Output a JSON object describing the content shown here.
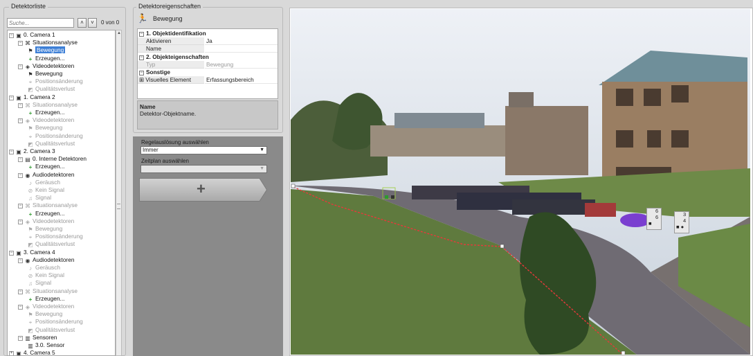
{
  "left": {
    "title": "Detektorliste",
    "search_placeholder": "Suche...",
    "up_icon": "chevron-up-icon",
    "down_icon": "chevron-down-icon",
    "count_text": "0 von 0",
    "tree": [
      {
        "label": "0. Camera 1",
        "level": 0,
        "icon": "camera-icon",
        "exp": "−",
        "dim": false
      },
      {
        "label": "Situationsanalyse",
        "level": 1,
        "icon": "analysis-icon",
        "exp": "−",
        "dim": false
      },
      {
        "label": "Bewegung",
        "level": 2,
        "icon": "runner-icon",
        "exp": "",
        "dim": false,
        "selected": true
      },
      {
        "label": "Erzeugen...",
        "level": 2,
        "icon": "plus-icon",
        "exp": "",
        "dim": false
      },
      {
        "label": "Videodetektoren",
        "level": 1,
        "icon": "video-detector-icon",
        "exp": "−",
        "dim": false
      },
      {
        "label": "Bewegung",
        "level": 2,
        "icon": "runner-icon",
        "exp": "",
        "dim": false
      },
      {
        "label": "Positionsänderung",
        "level": 2,
        "icon": "position-icon",
        "exp": "",
        "dim": true
      },
      {
        "label": "Qualitätsverlust",
        "level": 2,
        "icon": "quality-icon",
        "exp": "",
        "dim": true
      },
      {
        "label": "1. Camera 2",
        "level": 0,
        "icon": "camera-icon",
        "exp": "−",
        "dim": false
      },
      {
        "label": "Situationsanalyse",
        "level": 1,
        "icon": "analysis-icon",
        "exp": "−",
        "dim": true
      },
      {
        "label": "Erzeugen...",
        "level": 2,
        "icon": "plus-icon",
        "exp": "",
        "dim": false
      },
      {
        "label": "Videodetektoren",
        "level": 1,
        "icon": "video-detector-icon",
        "exp": "−",
        "dim": true
      },
      {
        "label": "Bewegung",
        "level": 2,
        "icon": "runner-icon",
        "exp": "",
        "dim": true
      },
      {
        "label": "Positionsänderung",
        "level": 2,
        "icon": "position-icon",
        "exp": "",
        "dim": true
      },
      {
        "label": "Qualitätsverlust",
        "level": 2,
        "icon": "quality-icon",
        "exp": "",
        "dim": true
      },
      {
        "label": "2. Camera 3",
        "level": 0,
        "icon": "camera-icon",
        "exp": "−",
        "dim": false
      },
      {
        "label": "0. Interne Detektoren",
        "level": 1,
        "icon": "internal-detector-icon",
        "exp": "−",
        "dim": false
      },
      {
        "label": "Erzeugen...",
        "level": 2,
        "icon": "plus-icon",
        "exp": "",
        "dim": false
      },
      {
        "label": "Audiodetektoren",
        "level": 1,
        "icon": "audio-detector-icon",
        "exp": "−",
        "dim": false
      },
      {
        "label": "Geräusch",
        "level": 2,
        "icon": "noise-icon",
        "exp": "",
        "dim": true
      },
      {
        "label": "Kein Signal",
        "level": 2,
        "icon": "no-signal-icon",
        "exp": "",
        "dim": true
      },
      {
        "label": "Signal",
        "level": 2,
        "icon": "signal-icon",
        "exp": "",
        "dim": true
      },
      {
        "label": "Situationsanalyse",
        "level": 1,
        "icon": "analysis-icon",
        "exp": "−",
        "dim": true
      },
      {
        "label": "Erzeugen...",
        "level": 2,
        "icon": "plus-icon",
        "exp": "",
        "dim": false
      },
      {
        "label": "Videodetektoren",
        "level": 1,
        "icon": "video-detector-icon",
        "exp": "−",
        "dim": true
      },
      {
        "label": "Bewegung",
        "level": 2,
        "icon": "runner-icon",
        "exp": "",
        "dim": true
      },
      {
        "label": "Positionsänderung",
        "level": 2,
        "icon": "position-icon",
        "exp": "",
        "dim": true
      },
      {
        "label": "Qualitätsverlust",
        "level": 2,
        "icon": "quality-icon",
        "exp": "",
        "dim": true
      },
      {
        "label": "3. Camera 4",
        "level": 0,
        "icon": "camera-icon",
        "exp": "−",
        "dim": false
      },
      {
        "label": "Audiodetektoren",
        "level": 1,
        "icon": "audio-detector-icon",
        "exp": "−",
        "dim": false
      },
      {
        "label": "Geräusch",
        "level": 2,
        "icon": "noise-icon",
        "exp": "",
        "dim": true
      },
      {
        "label": "Kein Signal",
        "level": 2,
        "icon": "no-signal-icon",
        "exp": "",
        "dim": true
      },
      {
        "label": "Signal",
        "level": 2,
        "icon": "signal-icon",
        "exp": "",
        "dim": true
      },
      {
        "label": "Situationsanalyse",
        "level": 1,
        "icon": "analysis-icon",
        "exp": "−",
        "dim": true
      },
      {
        "label": "Erzeugen...",
        "level": 2,
        "icon": "plus-icon",
        "exp": "",
        "dim": false
      },
      {
        "label": "Videodetektoren",
        "level": 1,
        "icon": "video-detector-icon",
        "exp": "−",
        "dim": true
      },
      {
        "label": "Bewegung",
        "level": 2,
        "icon": "runner-icon",
        "exp": "",
        "dim": true
      },
      {
        "label": "Positionsänderung",
        "level": 2,
        "icon": "position-icon",
        "exp": "",
        "dim": true
      },
      {
        "label": "Qualitätsverlust",
        "level": 2,
        "icon": "quality-icon",
        "exp": "",
        "dim": true
      },
      {
        "label": "Sensoren",
        "level": 1,
        "icon": "sensor-icon",
        "exp": "−",
        "dim": false
      },
      {
        "label": "3.0. Sensor",
        "level": 2,
        "icon": "sensor-icon",
        "exp": "",
        "dim": false
      },
      {
        "label": "4. Camera 5",
        "level": 0,
        "icon": "camera-icon",
        "exp": "+",
        "dim": false
      }
    ]
  },
  "middle": {
    "title": "Detektoreigenschaften",
    "header_icon": "runner-icon",
    "header_title": "Bewegung",
    "props": [
      {
        "type": "cat",
        "label": "1. Objektidentifikation",
        "toggle": "−"
      },
      {
        "type": "row",
        "key": "Aktivieren",
        "value": "Ja",
        "dim": false
      },
      {
        "type": "row",
        "key": "Name",
        "value": "",
        "dim": false
      },
      {
        "type": "cat",
        "label": "2. Objekteigenschaften",
        "toggle": "−"
      },
      {
        "type": "row",
        "key": "Typ",
        "value": "Bewegung",
        "dim": true
      },
      {
        "type": "cat",
        "label": "Sonstige",
        "toggle": "−"
      },
      {
        "type": "row",
        "key": "Visuelles Element",
        "value": "Erfassungsbereich",
        "dim": false,
        "expander": "+"
      }
    ],
    "desc_title": "Name",
    "desc_text": "Detektor-Objektname.",
    "rule_trigger_label": "Regelauslösung auswählen",
    "rule_trigger_value": "Immer",
    "schedule_label": "Zeitplan auswählen",
    "schedule_value": "",
    "add_button_label": "+"
  },
  "camera": {
    "badges": [
      {
        "top": "6",
        "mid": "6"
      },
      {
        "top": "3",
        "mid": "4"
      }
    ],
    "zone_color": "#e8383a"
  }
}
